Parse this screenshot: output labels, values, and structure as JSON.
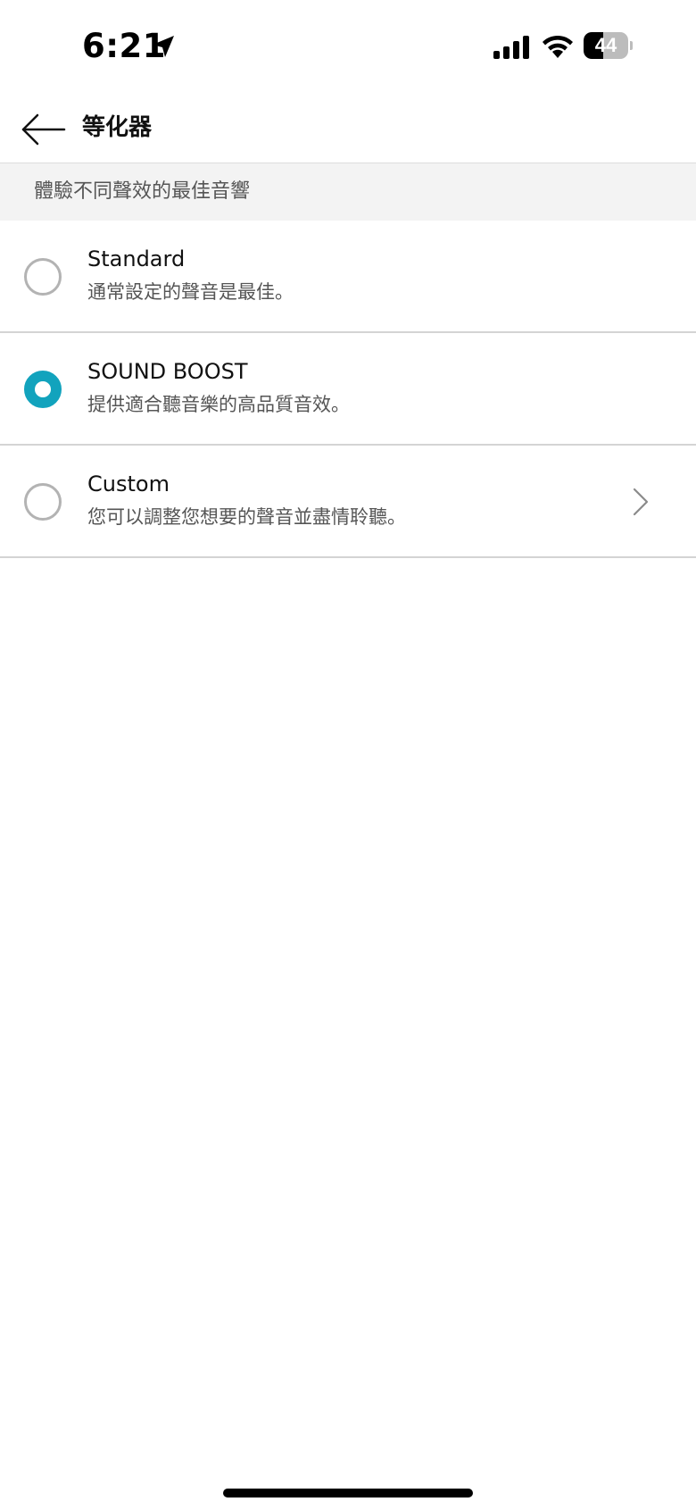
{
  "status_bar": {
    "time": "6:21",
    "battery_level": "44",
    "battery_fraction": 0.44,
    "icons": [
      "location-arrow-icon",
      "cellular-signal-icon",
      "wifi-icon",
      "battery-icon"
    ]
  },
  "header": {
    "title": "等化器",
    "back_icon": "back-arrow-icon"
  },
  "section": {
    "label": "體驗不同聲效的最佳音響"
  },
  "options": [
    {
      "title": "Standard",
      "description": "通常設定的聲音是最佳。",
      "selected": false,
      "has_chevron": false
    },
    {
      "title": "SOUND BOOST",
      "description": "提供適合聽音樂的高品質音效。",
      "selected": true,
      "has_chevron": false
    },
    {
      "title": "Custom",
      "description": "您可以調整您想要的聲音並盡情聆聽。",
      "selected": false,
      "has_chevron": true
    }
  ],
  "colors": {
    "accent": "#12a3bd",
    "section_background": "#f3f3f3",
    "divider": "#d4d4d4",
    "secondary_text": "#555555"
  }
}
